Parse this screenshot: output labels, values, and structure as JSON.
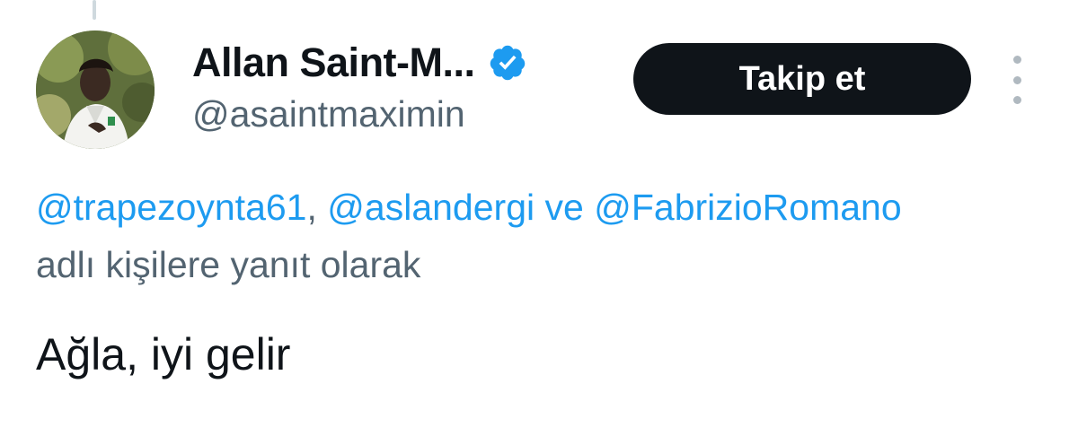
{
  "author": {
    "display_name": "Allan Saint-M...",
    "handle": "@asaintmaximin",
    "avatar_icon": "profile-photo",
    "verified_icon": "verified-badge-icon"
  },
  "actions": {
    "follow_label": "Takip et",
    "more_icon": "more-vertical-icon"
  },
  "reply_context": {
    "mentions": [
      "@trapezoynta61",
      "@aslandergi",
      "@FabrizioRomano"
    ],
    "separator": ",",
    "conjunction": "ve",
    "suffix": "adlı kişilere yanıt olarak"
  },
  "tweet": {
    "text": "Ağla, iyi gelir"
  },
  "colors": {
    "link": "#1d9bf0",
    "secondary_text": "#536471",
    "primary_text": "#0f1419",
    "follow_button_bg": "#0f1419",
    "verified": "#1d9bf0"
  }
}
